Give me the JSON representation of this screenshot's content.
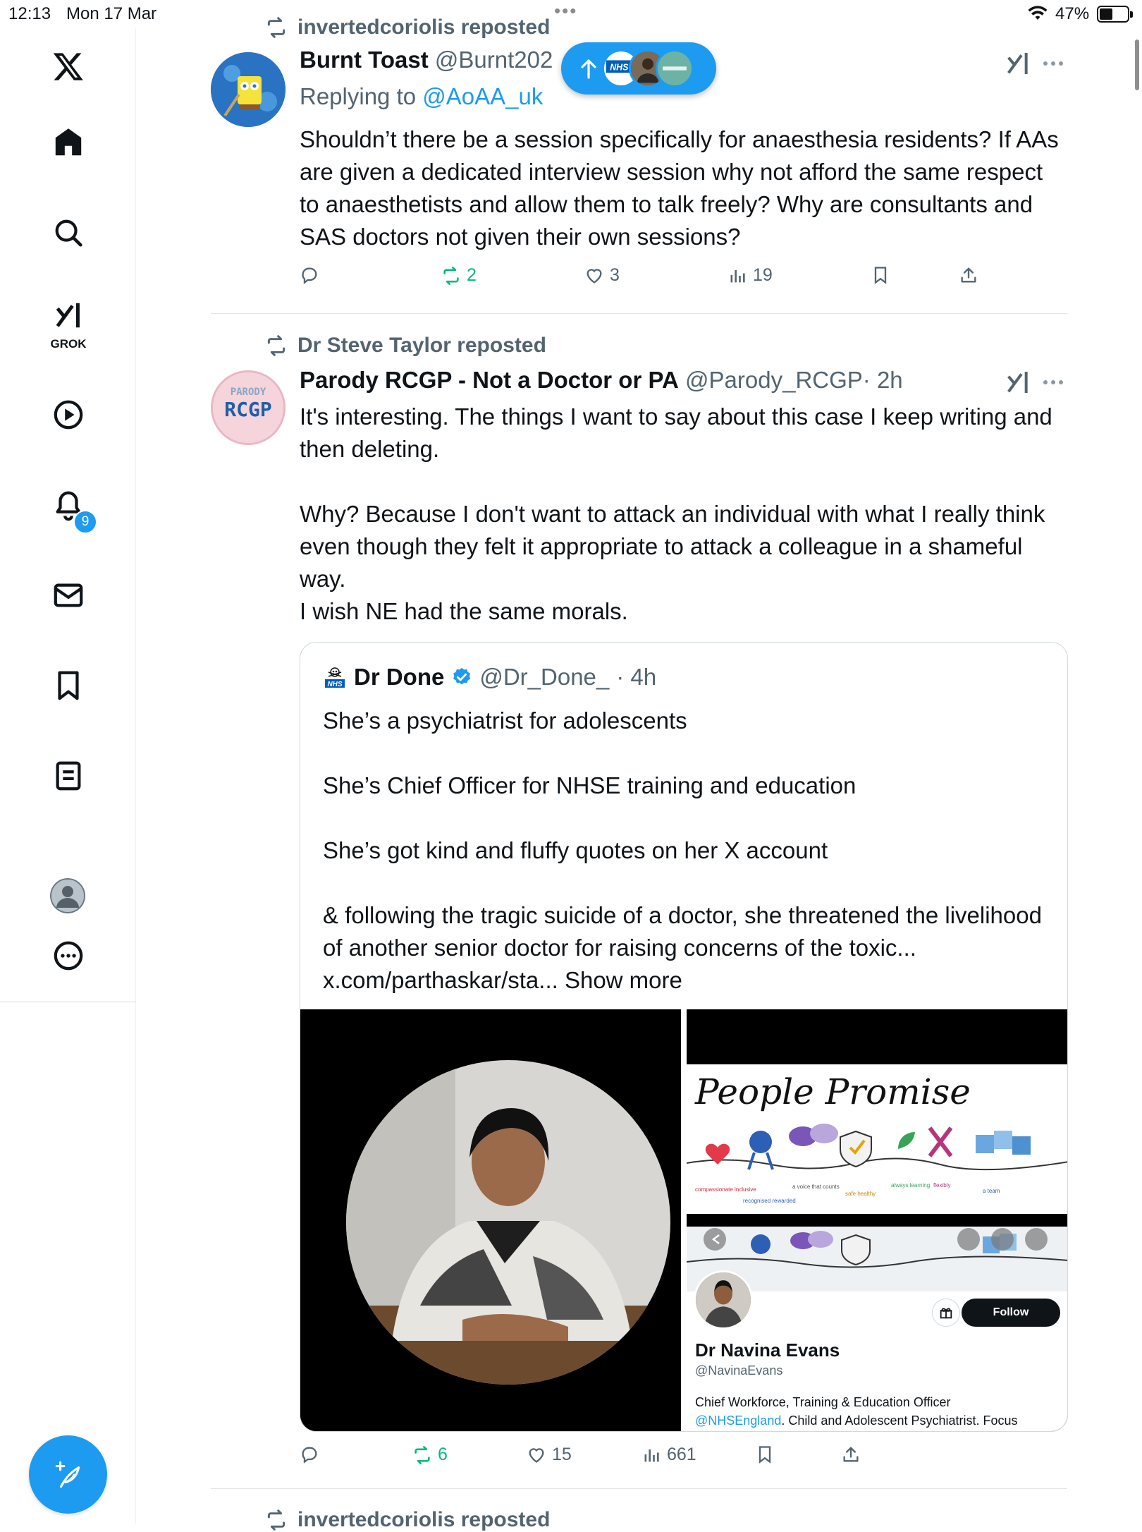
{
  "status_bar": {
    "time": "12:13",
    "date": "Mon 17 Mar",
    "battery": "47%"
  },
  "sidebar": {
    "grok_label": "GROK",
    "notification_count": "9"
  },
  "new_posts_pill": {
    "avatars": [
      "NHS",
      "person",
      "green-logo"
    ]
  },
  "posts": [
    {
      "repost_by": "invertedcoriolis reposted",
      "name": "Burnt Toast",
      "handle": "@Burnt202",
      "replying_prefix": "Replying to ",
      "replying_to": "@AoAA_uk",
      "text": "Shouldn’t there be a session specifically for anaesthesia residents? If AAs are given a dedicated interview session why not afford the same respect to anaesthetists and allow them to talk freely? Why are consultants and SAS doctors not given their own sessions?",
      "replies": "",
      "reposts": "2",
      "likes": "3",
      "views": "19"
    },
    {
      "repost_by": "Dr Steve Taylor reposted",
      "name": "Parody RCGP - Not a Doctor or PA",
      "handle": "@Parody_RCGP",
      "time": "· 2h",
      "avatar_text_top": "PARODY",
      "avatar_text_main": "RCGP",
      "text": "It's interesting. The things I want to say about this case I keep writing and then deleting.\n\nWhy? Because I don't want to attack an individual with what I really think even though they felt it appropriate to attack a colleague in a shameful way.\nI wish NE had the same morals.",
      "quote": {
        "name": "Dr Done",
        "handle": "@Dr_Done_",
        "time": "· 4h",
        "text": "She’s a psychiatrist for adolescents\n\nShe’s Chief Officer for NHSE training and education\n\nShe’s got kind and fluffy quotes on her X account\n\n& following the tragic suicide of a doctor, she threatened the livelihood of another senior doctor for raising concerns of the toxic... x.com/parthaskar/sta... Show more",
        "media_right": {
          "people_promise_title": "People Promise",
          "profile_name": "Dr Navina Evans",
          "profile_handle": "@NavinaEvans",
          "follow_label": "Follow",
          "bio_line1": "Chief Workforce, Training & Education Officer",
          "bio_link": "@NHSEngland",
          "bio_line2": ". Child and Adolescent Psychiatrist. Focus"
        }
      },
      "replies": "",
      "reposts": "6",
      "likes": "15",
      "views": "661"
    },
    {
      "repost_by": "invertedcoriolis reposted"
    }
  ],
  "colors": {
    "accent": "#1d9bf0",
    "repost_green": "#00ba7c",
    "muted": "#536471"
  }
}
